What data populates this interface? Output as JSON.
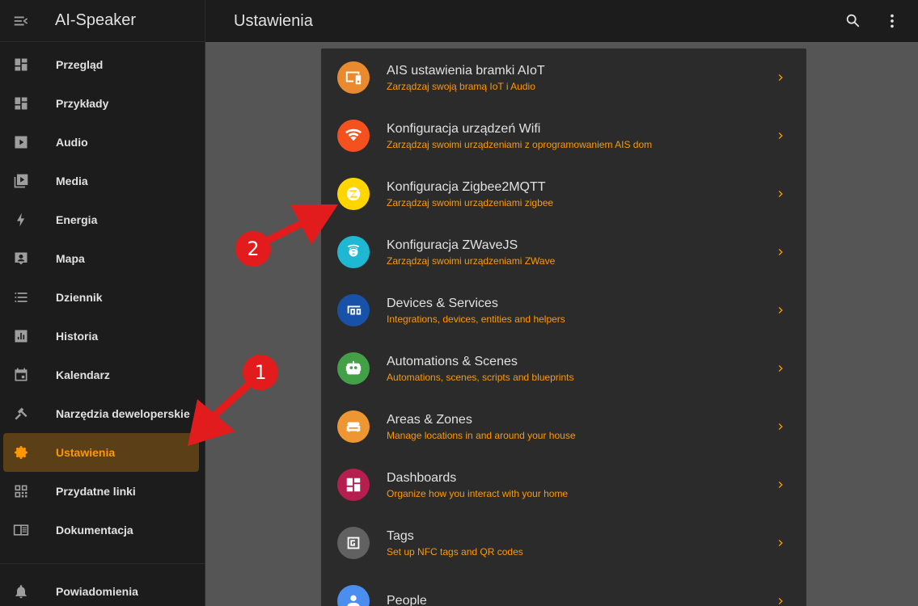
{
  "sidebar": {
    "title": "AI-Speaker",
    "items": [
      {
        "label": "Przegląd",
        "icon": "dashboard-icon"
      },
      {
        "label": "Przykłady",
        "icon": "dashboard-icon"
      },
      {
        "label": "Audio",
        "icon": "play-box-icon"
      },
      {
        "label": "Media",
        "icon": "media-library-icon"
      },
      {
        "label": "Energia",
        "icon": "lightning-icon"
      },
      {
        "label": "Mapa",
        "icon": "map-person-icon"
      },
      {
        "label": "Dziennik",
        "icon": "list-icon"
      },
      {
        "label": "Historia",
        "icon": "chart-box-icon"
      },
      {
        "label": "Kalendarz",
        "icon": "calendar-icon"
      },
      {
        "label": "Narzędzia deweloperskie",
        "icon": "hammer-icon"
      },
      {
        "label": "Ustawienia",
        "icon": "gear-icon",
        "active": true
      },
      {
        "label": "Przydatne linki",
        "icon": "qr-code-icon"
      },
      {
        "label": "Dokumentacja",
        "icon": "book-icon"
      }
    ],
    "notifications_label": "Powiadomienia"
  },
  "topbar": {
    "title": "Ustawienia"
  },
  "settings": [
    {
      "title": "AIS ustawienia bramki AIoT",
      "subtitle": "Zarządzaj swoją bramą IoT i Audio",
      "color": "#e98a2f"
    },
    {
      "title": "Konfiguracja urządzeń Wifi",
      "subtitle": "Zarządzaj swoimi urządzeniami z oprogramowaniem AIS dom",
      "color": "#f4511e"
    },
    {
      "title": "Konfiguracja Zigbee2MQTT",
      "subtitle": "Zarządzaj swoimi urządzeniami zigbee",
      "color": "#ffd600"
    },
    {
      "title": "Konfiguracja ZWaveJS",
      "subtitle": "Zarządzaj swoimi urządzeniami ZWave",
      "color": "#1fb8d2"
    },
    {
      "title": "Devices & Services",
      "subtitle": "Integrations, devices, entities and helpers",
      "color": "#1752a8"
    },
    {
      "title": "Automations & Scenes",
      "subtitle": "Automations, scenes, scripts and blueprints",
      "color": "#43a047"
    },
    {
      "title": "Areas & Zones",
      "subtitle": "Manage locations in and around your house",
      "color": "#ee9632"
    },
    {
      "title": "Dashboards",
      "subtitle": "Organize how you interact with your home",
      "color": "#b51e4f"
    },
    {
      "title": "Tags",
      "subtitle": "Set up NFC tags and QR codes",
      "color": "#616161"
    },
    {
      "title": "People",
      "subtitle": "",
      "color": "#4b8ef0"
    }
  ],
  "annotations": {
    "n1": "1",
    "n2": "2"
  }
}
